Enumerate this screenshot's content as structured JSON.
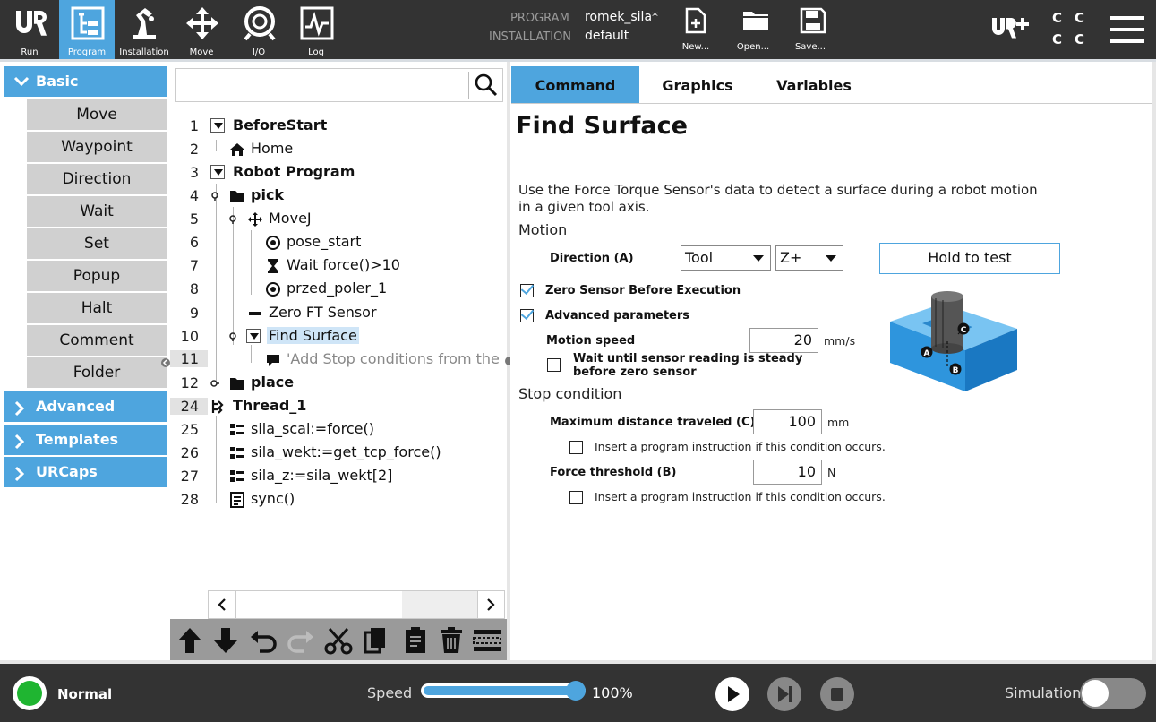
{
  "topbar": {
    "buttons": [
      {
        "label": "Run",
        "icon": "ur-logo-icon"
      },
      {
        "label": "Program",
        "icon": "program-icon"
      },
      {
        "label": "Installation",
        "icon": "installation-icon"
      },
      {
        "label": "Move",
        "icon": "move-icon"
      },
      {
        "label": "I/O",
        "icon": "io-icon"
      },
      {
        "label": "Log",
        "icon": "log-icon"
      }
    ],
    "program_label": "PROGRAM",
    "program_value": "romek_sila*",
    "installation_label": "INSTALLATION",
    "installation_value": "default",
    "file_buttons": {
      "new": "New...",
      "open": "Open...",
      "save": "Save..."
    },
    "status_letters": [
      "C",
      "C",
      "C",
      "C"
    ]
  },
  "sidebar": {
    "basic_label": "Basic",
    "basic_items": [
      "Move",
      "Waypoint",
      "Direction",
      "Wait",
      "Set",
      "Popup",
      "Halt",
      "Comment",
      "Folder"
    ],
    "categories": [
      "Advanced",
      "Templates",
      "URCaps"
    ]
  },
  "tree": {
    "search_placeholder": "",
    "lines": [
      {
        "num": "1",
        "text": "BeforeStart"
      },
      {
        "num": "2",
        "text": "Home"
      },
      {
        "num": "3",
        "text": "Robot Program"
      },
      {
        "num": "4",
        "text": "pick"
      },
      {
        "num": "5",
        "text": "MoveJ"
      },
      {
        "num": "6",
        "text": "pose_start"
      },
      {
        "num": "7",
        "text": "Wait force()>10"
      },
      {
        "num": "8",
        "text": "przed_poler_1"
      },
      {
        "num": "9",
        "text": "Zero FT Sensor"
      },
      {
        "num": "10",
        "text": "Find Surface"
      },
      {
        "num": "11",
        "text": "'Add Stop conditions from the"
      },
      {
        "num": "12",
        "text": "place"
      },
      {
        "num": "24",
        "text": "Thread_1"
      },
      {
        "num": "25",
        "text": "sila_scal:=force()"
      },
      {
        "num": "26",
        "text": "sila_wekt:=get_tcp_force()"
      },
      {
        "num": "27",
        "text": "sila_z:=sila_wekt[2]"
      },
      {
        "num": "28",
        "text": "sync()"
      }
    ],
    "toolbar_icons": [
      "move-up-icon",
      "move-down-icon",
      "undo-icon",
      "redo-icon",
      "cut-icon",
      "copy-icon",
      "paste-icon",
      "delete-icon",
      "suppress-icon"
    ]
  },
  "command": {
    "tabs": [
      "Command",
      "Graphics",
      "Variables"
    ],
    "title": "Find Surface",
    "description_line1": "Use the Force Torque Sensor's data to detect a surface during a robot motion",
    "description_line2": "in a given tool axis.",
    "motion_heading": "Motion",
    "direction_label": "Direction (A)",
    "direction_frame": "Tool",
    "direction_axis": "Z+",
    "hold_to_test": "Hold to test",
    "zero_sensor_label": "Zero Sensor Before Execution",
    "zero_sensor_checked": true,
    "advanced_label": "Advanced parameters",
    "advanced_checked": true,
    "motion_speed_label": "Motion speed",
    "motion_speed_value": "20",
    "motion_speed_unit": "mm/s",
    "wait_steady_line1": "Wait until sensor reading is steady",
    "wait_steady_line2": "before zero sensor",
    "wait_steady_checked": false,
    "stop_heading": "Stop condition",
    "max_distance_label": "Maximum distance traveled (C)",
    "max_distance_value": "100",
    "max_distance_unit": "mm",
    "insert_instruction_label": "Insert a program instruction if this condition occurs.",
    "force_threshold_label": "Force threshold (B)",
    "force_threshold_value": "10",
    "force_threshold_unit": "N",
    "diagram_labels": [
      "A",
      "B",
      "C"
    ]
  },
  "bottombar": {
    "status": "Normal",
    "speed_label": "Speed",
    "speed_value": "100%",
    "speed_fraction": 1.0,
    "simulation_label": "Simulation",
    "simulation_on": false
  },
  "colors": {
    "accent": "#4ea5de",
    "topbar": "#333333",
    "status_ok": "#1fb531"
  }
}
